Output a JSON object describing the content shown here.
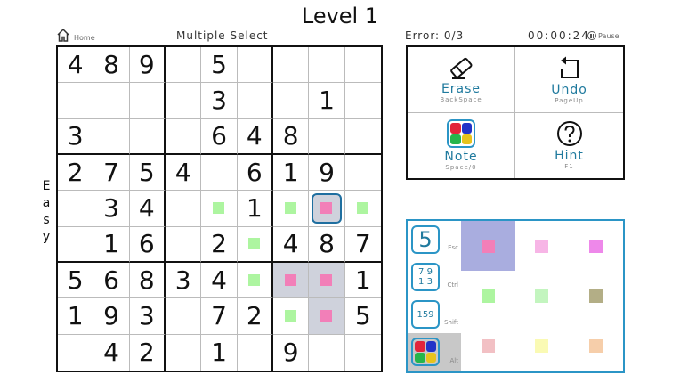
{
  "title": "Level 1",
  "header": {
    "home_label": "Home",
    "multiple_select": "Multiple Select",
    "error": "Error: 0/3",
    "timer": "00:00:24",
    "pause_label": "Pause"
  },
  "difficulty": [
    "E",
    "a",
    "s",
    "y"
  ],
  "board": {
    "rows": [
      [
        "4",
        "8",
        "9",
        "",
        "5",
        "",
        "",
        "",
        ""
      ],
      [
        "",
        "",
        "",
        "",
        "3",
        "",
        "",
        "1",
        ""
      ],
      [
        "3",
        "",
        "",
        "",
        "6",
        "4",
        "8",
        "",
        ""
      ],
      [
        "2",
        "7",
        "5",
        "4",
        "",
        "6",
        "1",
        "9",
        ""
      ],
      [
        "",
        "3",
        "4",
        "",
        "",
        "1",
        "",
        "",
        ""
      ],
      [
        "",
        "1",
        "6",
        "",
        "2",
        "",
        "4",
        "8",
        "7"
      ],
      [
        "5",
        "6",
        "8",
        "3",
        "4",
        "",
        "",
        "",
        "1"
      ],
      [
        "1",
        "9",
        "3",
        "",
        "7",
        "2",
        "",
        "",
        "5"
      ],
      [
        "",
        "4",
        "2",
        "",
        "1",
        "",
        "9",
        "",
        ""
      ]
    ],
    "marks": [
      {
        "r": 4,
        "c": 4,
        "color": "#adf5a0"
      },
      {
        "r": 4,
        "c": 6,
        "color": "#adf5a0"
      },
      {
        "r": 4,
        "c": 7,
        "color": "#f27fb8"
      },
      {
        "r": 4,
        "c": 8,
        "color": "#adf5a0"
      },
      {
        "r": 5,
        "c": 5,
        "color": "#adf5a0"
      },
      {
        "r": 6,
        "c": 5,
        "color": "#adf5a0"
      },
      {
        "r": 6,
        "c": 6,
        "color": "#f27fb8"
      },
      {
        "r": 6,
        "c": 7,
        "color": "#f27fb8"
      },
      {
        "r": 7,
        "c": 6,
        "color": "#adf5a0"
      },
      {
        "r": 7,
        "c": 7,
        "color": "#f27fb8"
      }
    ],
    "selected": [
      {
        "r": 4,
        "c": 7
      },
      {
        "r": 6,
        "c": 6
      },
      {
        "r": 6,
        "c": 7
      },
      {
        "r": 7,
        "c": 7
      }
    ],
    "cursor": {
      "r": 4,
      "c": 7
    }
  },
  "actions": {
    "erase": {
      "label": "Erase",
      "key": "BackSpace",
      "icon": "eraser-icon"
    },
    "undo": {
      "label": "Undo",
      "key": "PageUp",
      "icon": "undo-icon"
    },
    "note": {
      "label": "Note",
      "key": "Space/0",
      "icon": "color-note-icon"
    },
    "hint": {
      "label": "Hint",
      "key": "F1",
      "icon": "question-icon"
    }
  },
  "palette": {
    "modes": [
      {
        "name": "single-digit",
        "glyph": "5",
        "key": "Esc",
        "active": false
      },
      {
        "name": "corner-notes",
        "glyph": "7 9 1 3",
        "key": "Ctrl",
        "active": false
      },
      {
        "name": "center-notes",
        "glyph": "159",
        "key": "Shift",
        "active": false
      },
      {
        "name": "color",
        "glyph": "",
        "key": "Alt",
        "active": true
      }
    ],
    "colors": [
      "#f27fb8",
      "#f7b5e6",
      "#ee88ea",
      "#adf5a0",
      "#c3f5bf",
      "#b3ae86",
      "#f2c0c4",
      "#fafab4",
      "#f6ceaa"
    ],
    "selected_color_index": 0
  }
}
